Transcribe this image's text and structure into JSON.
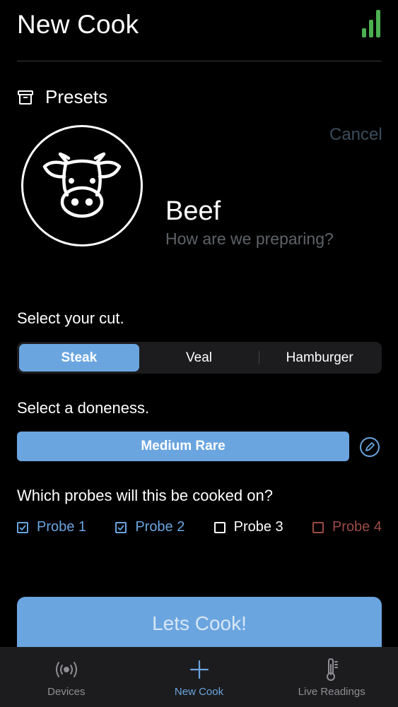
{
  "header": {
    "title": "New Cook"
  },
  "presets": {
    "label": "Presets"
  },
  "cancel_label": "Cancel",
  "meat": {
    "name": "Beef",
    "subtitle": "How are we preparing?"
  },
  "cut": {
    "prompt": "Select your cut.",
    "options": [
      "Steak",
      "Veal",
      "Hamburger"
    ],
    "selected": "Steak"
  },
  "doneness": {
    "prompt": "Select a doneness.",
    "value": "Medium Rare"
  },
  "probes": {
    "prompt": "Which probes will this be cooked on?",
    "items": [
      {
        "label": "Probe 1",
        "checked": true,
        "color": "#6aa5e0"
      },
      {
        "label": "Probe 2",
        "checked": true,
        "color": "#6aa5e0"
      },
      {
        "label": "Probe 3",
        "checked": false,
        "color": "#ffffff"
      },
      {
        "label": "Probe 4",
        "checked": false,
        "color": "#9b4b46"
      }
    ]
  },
  "cook_button": {
    "label": "Lets Cook!"
  },
  "tabbar": {
    "items": [
      {
        "label": "Devices",
        "icon": "broadcast-icon",
        "active": false
      },
      {
        "label": "New Cook",
        "icon": "plus-icon",
        "active": true
      },
      {
        "label": "Live Readings",
        "icon": "thermometer-icon",
        "active": false
      }
    ]
  },
  "colors": {
    "accent": "#6aa5e0",
    "signal": "#4caf50",
    "background": "#000000"
  }
}
